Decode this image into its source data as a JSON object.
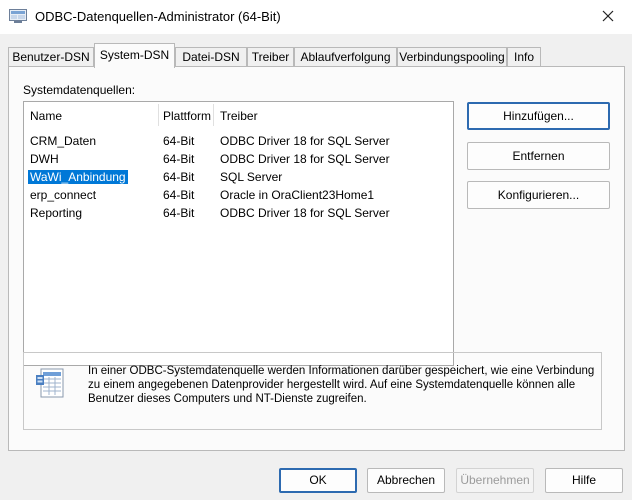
{
  "window": {
    "title": "ODBC-Datenquellen-Administrator (64-Bit)",
    "close_icon": "close-icon",
    "app_icon": "odbc-app-icon"
  },
  "tabs": [
    {
      "label": "Benutzer-DSN",
      "active": false
    },
    {
      "label": "System-DSN",
      "active": true
    },
    {
      "label": "Datei-DSN",
      "active": false
    },
    {
      "label": "Treiber",
      "active": false
    },
    {
      "label": "Ablaufverfolgung",
      "active": false
    },
    {
      "label": "Verbindungspooling",
      "active": false
    },
    {
      "label": "Info",
      "active": false
    }
  ],
  "system_dsn": {
    "group_label": "Systemdatenquellen:",
    "columns": [
      "Name",
      "Plattform",
      "Treiber"
    ],
    "rows": [
      {
        "name": "CRM_Daten",
        "platform": "64-Bit",
        "driver": "ODBC Driver 18 for SQL Server",
        "selected": false
      },
      {
        "name": "DWH",
        "platform": "64-Bit",
        "driver": "ODBC Driver 18 for SQL Server",
        "selected": false
      },
      {
        "name": "WaWi_Anbindung",
        "platform": "64-Bit",
        "driver": "SQL Server",
        "selected": true
      },
      {
        "name": "erp_connect",
        "platform": "64-Bit",
        "driver": "Oracle in OraClient23Home1",
        "selected": false
      },
      {
        "name": "Reporting",
        "platform": "64-Bit",
        "driver": "ODBC Driver 18 for SQL Server",
        "selected": false
      }
    ],
    "buttons": {
      "add": "Hinzufügen...",
      "remove": "Entfernen",
      "configure": "Konfigurieren..."
    },
    "info_text": "In einer ODBC-Systemdatenquelle werden Informationen darüber gespeichert, wie eine Verbindung zu einem angegebenen Datenprovider hergestellt wird. Auf eine Systemdatenquelle können alle Benutzer dieses Computers und NT-Dienste zugreifen.",
    "info_icon": "data-source-icon"
  },
  "footer": {
    "ok": "OK",
    "cancel": "Abbrechen",
    "apply": "Übernehmen",
    "help": "Hilfe"
  },
  "colors": {
    "selection": "#0078d7",
    "primary_border": "#2d6ab0",
    "window_bg": "#f0f0f0"
  }
}
